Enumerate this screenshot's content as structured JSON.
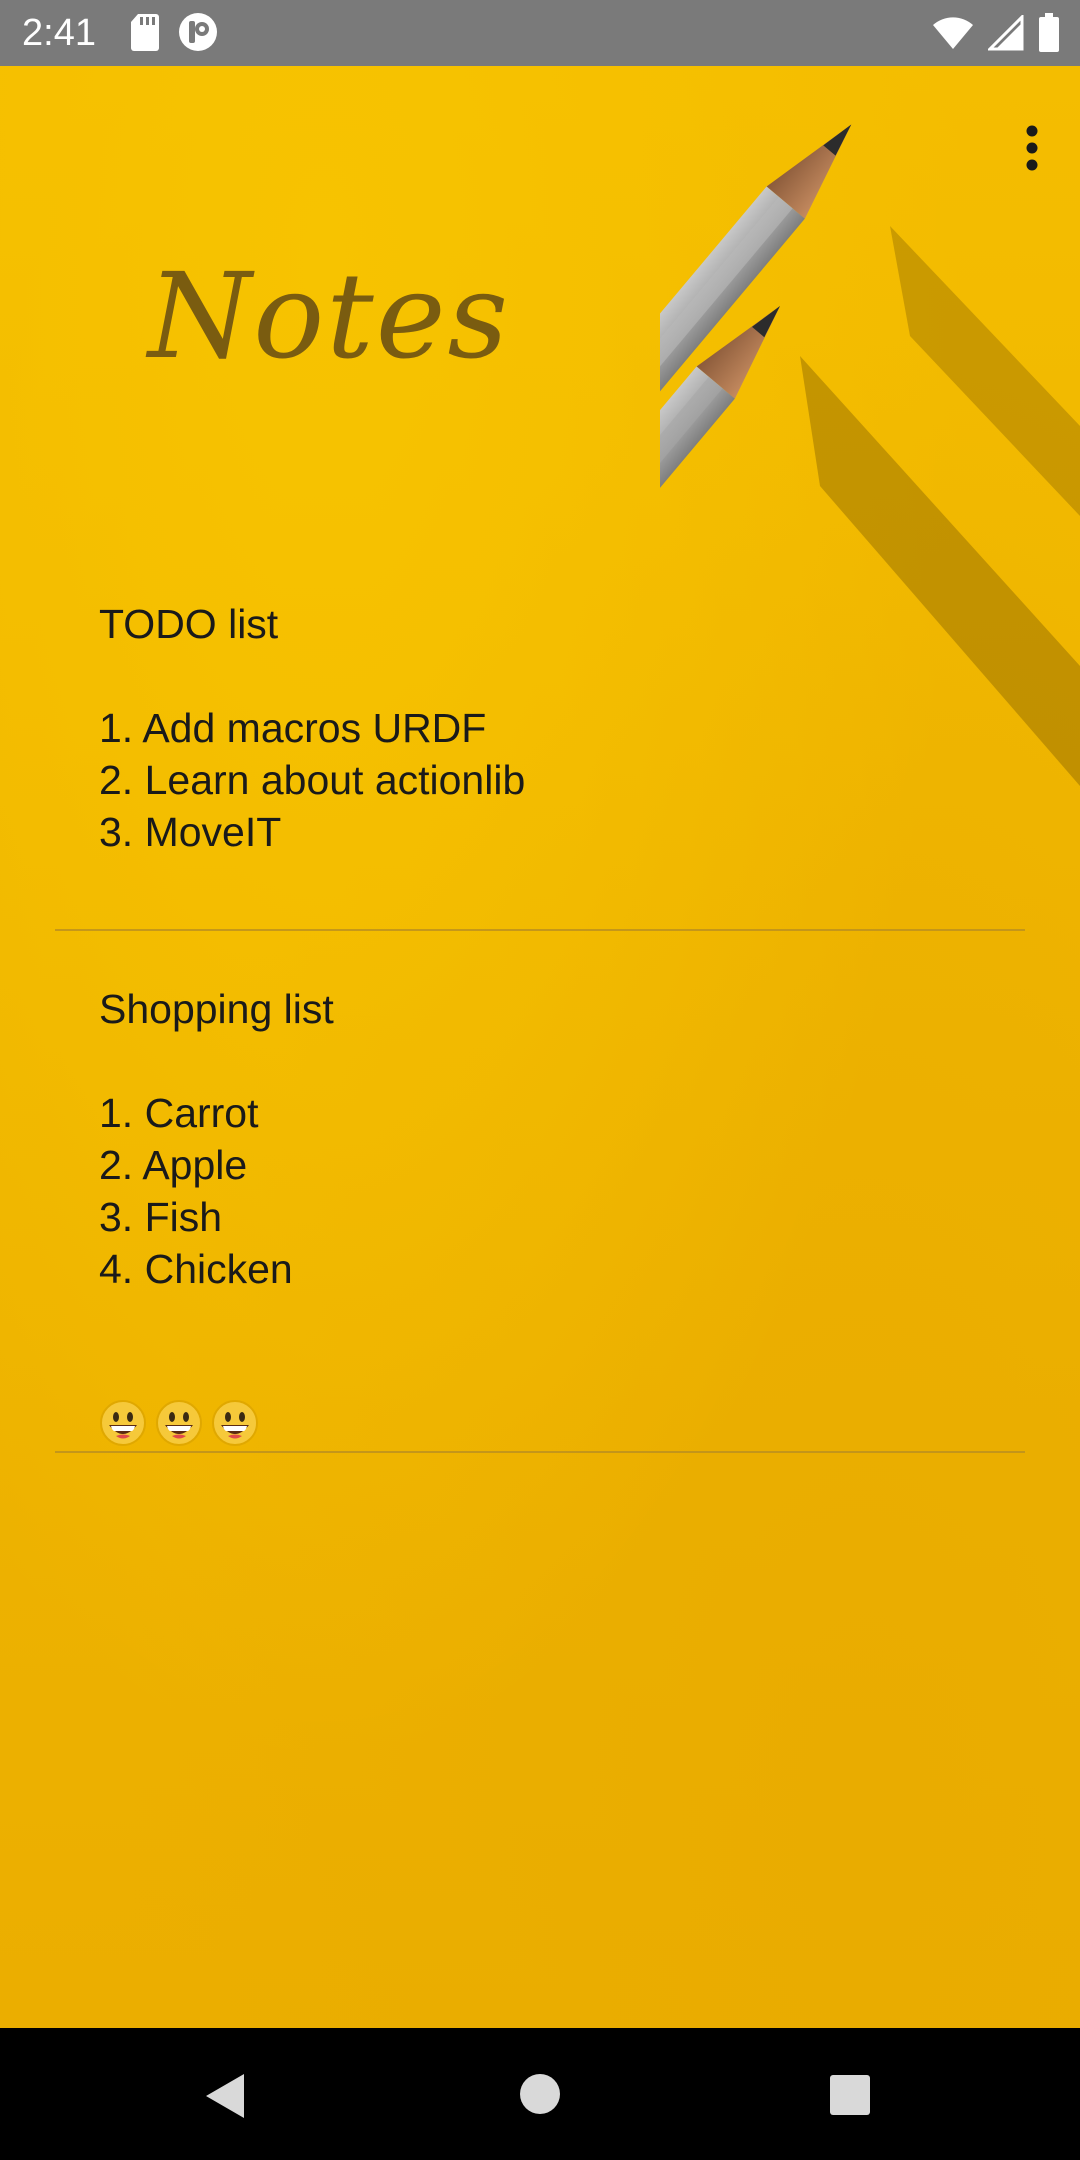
{
  "status_bar": {
    "time": "2:41",
    "icons_left": [
      "sd-card-icon",
      "notification-app-icon"
    ],
    "icons_right": [
      "wifi-icon",
      "signal-icon",
      "battery-icon"
    ]
  },
  "app": {
    "title": "Notes",
    "menu_icon": "more-vert-icon"
  },
  "notes": [
    {
      "text": "TODO list\n\n1. Add macros URDF\n2. Learn about actionlib\n3. MoveIT"
    },
    {
      "text": "Shopping list\n\n1. Carrot\n2. Apple\n3. Fish\n4. Chicken",
      "emoji": [
        "grinning-face-icon",
        "grinning-face-icon",
        "grinning-face-icon"
      ]
    }
  ],
  "nav_bar": {
    "items": [
      "back-icon",
      "home-icon",
      "recents-icon"
    ]
  },
  "colors": {
    "background": "#f0b600",
    "title": "#7a5c10",
    "text": "#1a1a1a",
    "status_bar": "#7a7a7a",
    "nav_bar": "#000000"
  }
}
